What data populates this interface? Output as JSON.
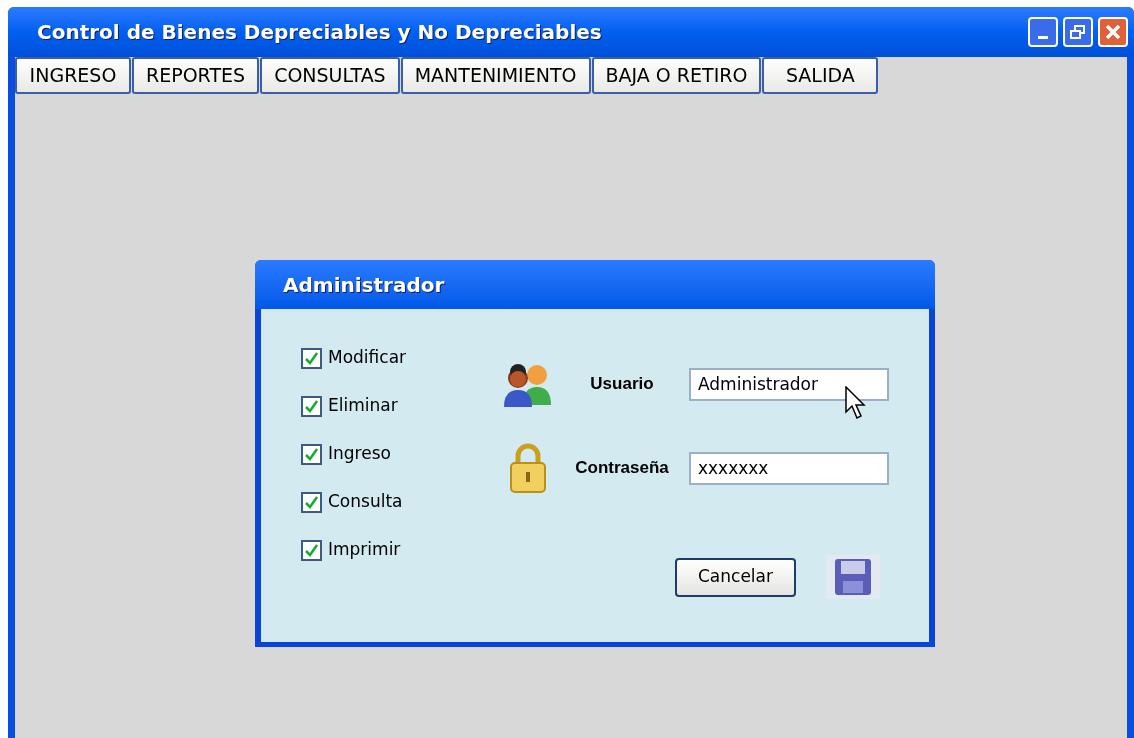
{
  "window": {
    "title": "Control de Bienes Depreciables y No Depreciables"
  },
  "menu": [
    {
      "label": "INGRESO"
    },
    {
      "label": "REPORTES"
    },
    {
      "label": "CONSULTAS"
    },
    {
      "label": "MANTENIMIENTO"
    },
    {
      "label": "BAJA O RETIRO"
    },
    {
      "label": "SALIDA"
    }
  ],
  "dialog": {
    "title": "Administrador",
    "permissions": [
      {
        "label": "Modificar",
        "checked": true
      },
      {
        "label": "Eliminar",
        "checked": true
      },
      {
        "label": "Ingreso",
        "checked": true
      },
      {
        "label": "Consulta",
        "checked": true
      },
      {
        "label": "Imprimir",
        "checked": true
      }
    ],
    "fields": [
      {
        "kind": "user",
        "label": "Usuario",
        "value": "Administrador"
      },
      {
        "kind": "password",
        "label": "Contraseña",
        "value": "xxxxxxx"
      }
    ],
    "cancel_button": "Cancelar"
  }
}
